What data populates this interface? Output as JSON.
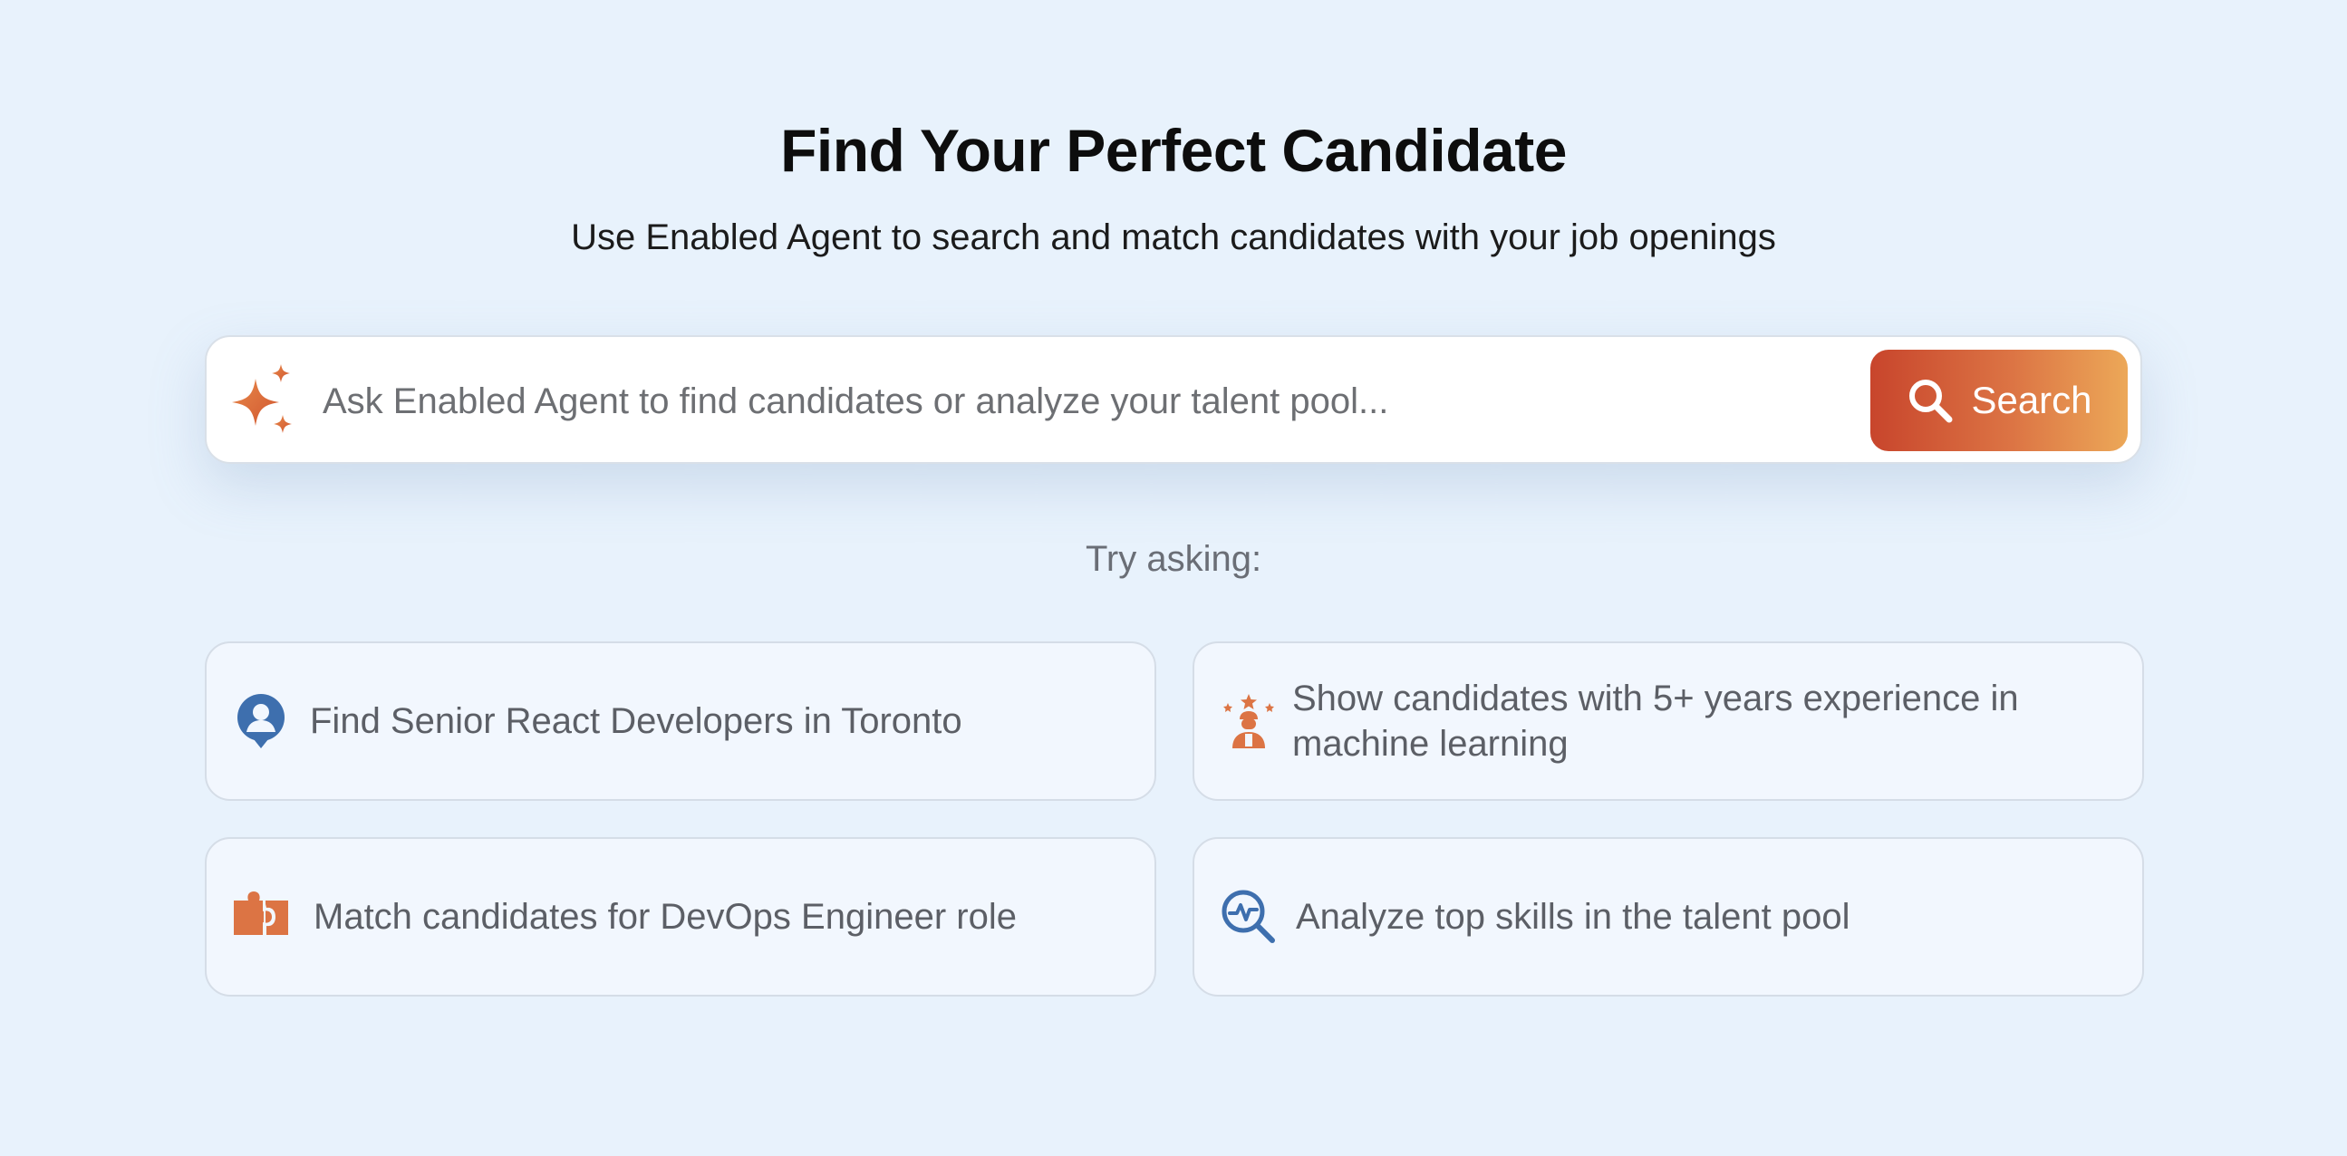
{
  "header": {
    "title": "Find Your Perfect Candidate",
    "subtitle": "Use Enabled Agent to search and match candidates with your job openings"
  },
  "search": {
    "icon": "sparkle-icon",
    "placeholder": "Ask Enabled Agent to find candidates or analyze your talent pool...",
    "value": "",
    "button_label": "Search",
    "button_icon": "search-icon"
  },
  "suggestions": {
    "label": "Try asking:",
    "items": [
      {
        "icon": "user-location-icon",
        "text": "Find Senior React Developers in Toronto"
      },
      {
        "icon": "star-expert-icon",
        "text": "Show candidates with 5+ years experience in machine learning"
      },
      {
        "icon": "puzzle-icon",
        "text": "Match candidates for DevOps Engineer role"
      },
      {
        "icon": "analytics-search-icon",
        "text": "Analyze top skills in the talent pool"
      }
    ]
  },
  "colors": {
    "background": "#e8f2fc",
    "accent_start": "#c8452c",
    "accent_end": "#eca858",
    "icon_orange": "#dc7444",
    "icon_blue": "#3e6fae"
  }
}
